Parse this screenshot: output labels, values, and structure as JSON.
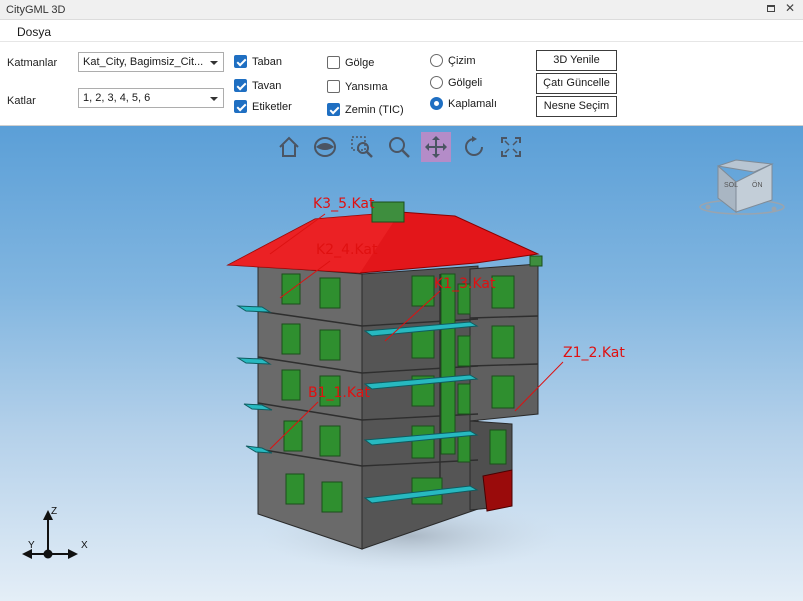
{
  "window": {
    "title": "CityGML 3D"
  },
  "menu": {
    "items": [
      "Dosya"
    ]
  },
  "controls": {
    "layers_label": "Katmanlar",
    "layers_value": "Kat_City, Bagimsiz_Cit...",
    "floors_label": "Katlar",
    "floors_value": "1, 2, 3, 4, 5, 6",
    "checkboxes": [
      {
        "label": "Taban",
        "checked": true
      },
      {
        "label": "Tavan",
        "checked": true
      },
      {
        "label": "Etiketler",
        "checked": true
      },
      {
        "label": "Gölge",
        "checked": false
      },
      {
        "label": "Yansıma",
        "checked": false
      },
      {
        "label": "Zemin (TIC)",
        "checked": true
      }
    ],
    "radios": [
      {
        "label": "Çizim",
        "selected": false
      },
      {
        "label": "Gölgeli",
        "selected": false
      },
      {
        "label": "Kaplamalı",
        "selected": true
      }
    ],
    "buttons": [
      "3D Yenile",
      "Çatı Güncelle",
      "Nesne Seçim"
    ]
  },
  "toolbar": {
    "tools": [
      {
        "icon": "home-icon",
        "active": false
      },
      {
        "icon": "eye-icon",
        "active": false
      },
      {
        "icon": "zoom-window-icon",
        "active": false
      },
      {
        "icon": "zoom-icon",
        "active": false
      },
      {
        "icon": "pan-icon",
        "active": true
      },
      {
        "icon": "rotate-icon",
        "active": false
      },
      {
        "icon": "fit-extents-icon",
        "active": false
      }
    ]
  },
  "scene": {
    "floor_labels": [
      "K3_5.Kat",
      "K2_4.Kat",
      "K1_3.Kat",
      "Z1_2.Kat",
      "B1_1.Kat"
    ],
    "view_cube": {
      "left_face": "SOL",
      "front_face": "ÖN"
    },
    "axes": {
      "x": "X",
      "y": "Y",
      "z": "Z"
    },
    "colors": {
      "roof": "#e3161a",
      "wall": "#5a5a5a",
      "window": "#2f8f2f",
      "balcony": "#27b9c0",
      "door": "#9a0b0b"
    }
  }
}
